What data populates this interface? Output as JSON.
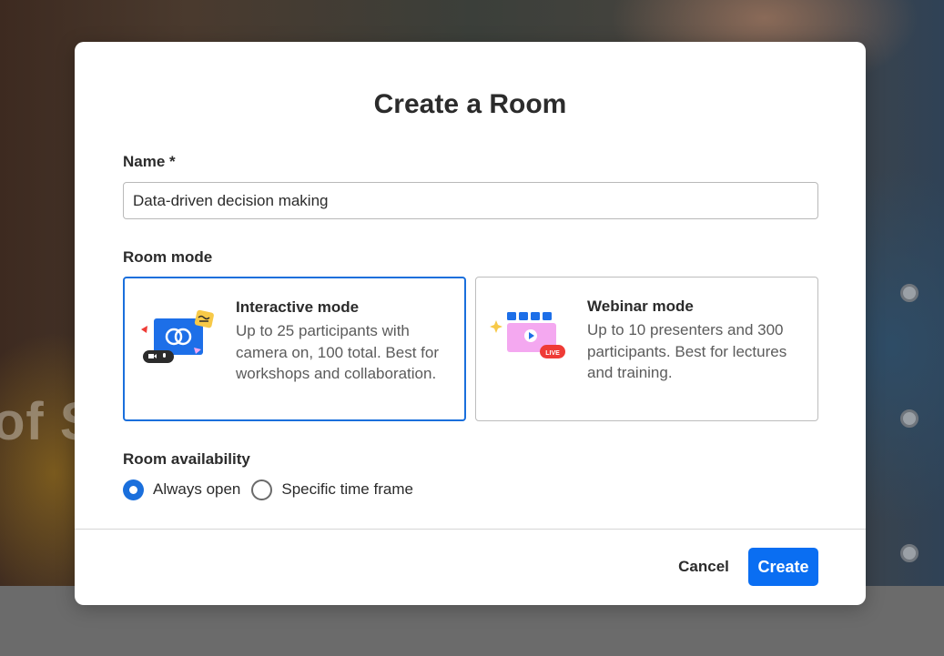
{
  "background": {
    "partial_text": "of S"
  },
  "modal": {
    "title": "Create a Room",
    "name_label": "Name *",
    "name_value": "Data-driven decision making",
    "room_mode_label": "Room mode",
    "modes": [
      {
        "title": "Interactive mode",
        "description": "Up to 25 participants with camera on, 100 total. Best for workshops and collaboration.",
        "selected": true
      },
      {
        "title": "Webinar mode",
        "description": "Up to 10 presenters and 300 participants. Best for lectures and training.",
        "selected": false,
        "badge": "LIVE"
      }
    ],
    "availability_label": "Room availability",
    "availability_options": [
      {
        "label": "Always open",
        "checked": true
      },
      {
        "label": "Specific time frame",
        "checked": false
      }
    ],
    "cancel_label": "Cancel",
    "create_label": "Create"
  },
  "colors": {
    "accent": "#1a6fdc",
    "create_button": "#0a6ef2",
    "illustration_blue": "#1d6fe8",
    "illustration_pink": "#f4a8f0",
    "live_badge": "#ef3b36",
    "sparkle_yellow": "#f7c948"
  },
  "icons": {
    "interactive": "interactive-mode-illustration",
    "webinar": "webinar-mode-illustration"
  }
}
